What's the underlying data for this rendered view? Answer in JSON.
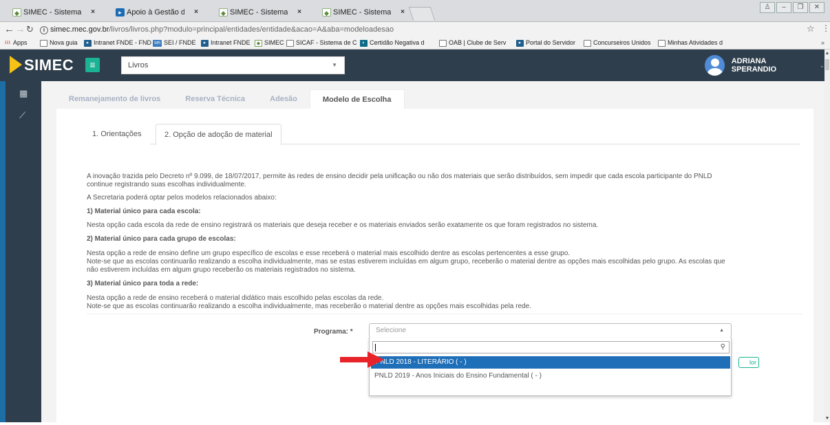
{
  "browser": {
    "tabs": [
      {
        "title": "SIMEC - Sistema Integrad",
        "icon": "simec-favicon"
      },
      {
        "title": "Apoio à Gestão do Livro",
        "icon": "fnde-favicon"
      },
      {
        "title": "SIMEC - Sistema Integrad",
        "icon": "simec-favicon"
      },
      {
        "title": "SIMEC - Sistema Integrad",
        "icon": "simec-favicon"
      }
    ],
    "url_host": "simec.mec.gov.br",
    "url_path": "/livros/livros.php?modulo=principal/entidades/entidade&acao=A&aba=modeloadesao",
    "bookmarks": [
      "Apps",
      "Nova guia",
      "Intranet FNDE - FND",
      "SEI / FNDE",
      "Intranet FNDE",
      "SIMEC",
      "SICAF - Sistema de C",
      "Certidão Negativa d",
      "OAB | Clube de Serv",
      "Portal do Servidor",
      "Concurseiros Unidos",
      "Minhas Atividades d"
    ]
  },
  "app": {
    "logo": "SIMEC",
    "module_select": "Livros",
    "user_name": "ADRIANA SPERANDIO"
  },
  "main_tabs": [
    "Remanejamento de livros",
    "Reserva Técnica",
    "Adesão",
    "Modelo de Escolha"
  ],
  "sub_tabs": [
    "1. Orientações",
    "2. Opção de adoção de material"
  ],
  "body": {
    "p1": "A inovação trazida pelo Decreto nº 9.099, de 18/07/2017, permite às redes de ensino decidir pela unificação ou não dos materiais que serão distribuídos, sem impedir que cada escola participante do PNLD",
    "p1b": "continue registrando suas escolhas individualmente.",
    "p2": "A Secretaria poderá optar pelos modelos relacionados abaixo:",
    "h1": "1) Material único para cada escola:",
    "p3": "Nesta opção cada escola da rede de ensino registrará os materiais que deseja receber e os materiais enviados serão exatamente os que foram registrados no sistema.",
    "h2": "2) Material único para cada grupo de escolas:",
    "p4": "Nesta opção a rede de ensino define um grupo específico de escolas e esse receberá o material mais escolhido dentre as escolas pertencentes a esse grupo.",
    "p5": "Note-se que as escolas continuarão realizando a escolha individualmente, mas se estas estiverem incluídas em algum grupo, receberão o material dentre as opções mais escolhidas pelo grupo. As escolas que",
    "p5b": "não estiverem incluídas em algum grupo receberão os materiais registrados no sistema.",
    "h3": "3) Material único para toda a rede:",
    "p6": "Nesta opção a rede de ensino receberá o material didático mais escolhido pelas escolas da rede.",
    "p7": "Note-se que as escolas continuarão realizando a escolha individualmente, mas receberão o material dentre as opções mais escolhidas pela rede."
  },
  "form": {
    "programa_label": "Programa: *",
    "programa_placeholder": "Selecione",
    "options": [
      "PNLD 2018 - LITERÁRIO ( - )",
      "PNLD 2019 - Anos Iniciais do Ensino Fundamental ( - )"
    ],
    "partial_button": "lor"
  },
  "colors": {
    "topbar": "#2e3e4c",
    "accent_green": "#1ab394",
    "selected_option": "#1f6fb8",
    "arrow": "#e8242a"
  }
}
